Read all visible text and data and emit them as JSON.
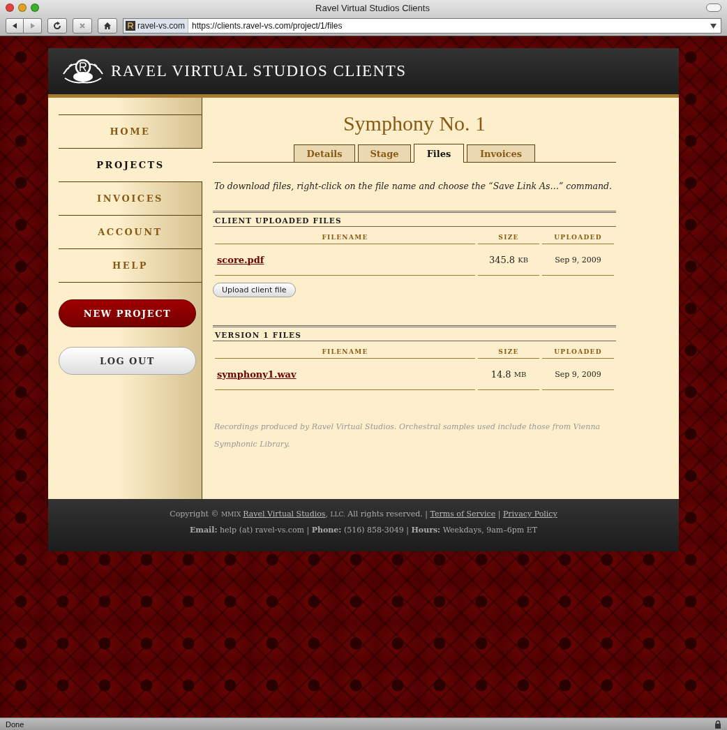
{
  "window": {
    "title": "Ravel Virtual Studios Clients"
  },
  "toolbar": {
    "site_name": "ravel-vs.com",
    "url": "https://clients.ravel-vs.com/project/1/files"
  },
  "header": {
    "title": "RAVEL VIRTUAL STUDIOS CLIENTS"
  },
  "nav": [
    {
      "label": "HOME",
      "selected": false
    },
    {
      "label": "PROJECTS",
      "selected": true
    },
    {
      "label": "INVOICES",
      "selected": false
    },
    {
      "label": "ACCOUNT",
      "selected": false
    },
    {
      "label": "HELP",
      "selected": false
    }
  ],
  "sidebar_buttons": [
    {
      "label": "NEW PROJECT",
      "kind": "primary"
    },
    {
      "label": "LOG OUT",
      "kind": "secondary"
    }
  ],
  "page_title": "Symphony No. 1",
  "tabs": [
    {
      "label": "Details",
      "selected": false
    },
    {
      "label": "Stage",
      "selected": false
    },
    {
      "label": "Files",
      "selected": true
    },
    {
      "label": "Invoices",
      "selected": false
    }
  ],
  "instructions": "To download files, right-click on the file name and choose the “Save Link As…” command.",
  "sections": [
    {
      "title": "CLIENT UPLOADED FILES",
      "columns": [
        "FILENAME",
        "SIZE",
        "UPLOADED"
      ],
      "rows": [
        {
          "filename": "score.pdf",
          "size": "345.8",
          "unit": "KB",
          "uploaded": "Sep 9, 2009"
        }
      ],
      "button": "Upload client file"
    },
    {
      "title": "VERSION 1 FILES",
      "columns": [
        "FILENAME",
        "SIZE",
        "UPLOADED"
      ],
      "rows": [
        {
          "filename": "symphony1.wav",
          "size": "14.8",
          "unit": "MB",
          "uploaded": "Sep 9, 2009"
        }
      ]
    }
  ],
  "credits": "Recordings produced by Ravel Virtual Studios. Orchestral samples used include those from Vienna Symphonic Library.",
  "footer": {
    "line_1": [
      {
        "kind": "text",
        "text": "Copyright © "
      },
      {
        "kind": "small",
        "text": "MMIX "
      },
      {
        "kind": "link",
        "text": "Ravel Virtual Studios"
      },
      {
        "kind": "text",
        "text": ", "
      },
      {
        "kind": "small",
        "text": "LLC."
      },
      {
        "kind": "text",
        "text": " All rights reserved. | "
      },
      {
        "kind": "link",
        "text": "Terms of Service"
      },
      {
        "kind": "text",
        "text": " | "
      },
      {
        "kind": "link",
        "text": "Privacy Policy"
      }
    ],
    "line_2": "**Email:** help (at) ravel-vs.com | **Phone:** (516) 858-3049 | **Hours:** Weekdays, 9am–6pm ET"
  },
  "status_bar": {
    "text": "Done"
  }
}
